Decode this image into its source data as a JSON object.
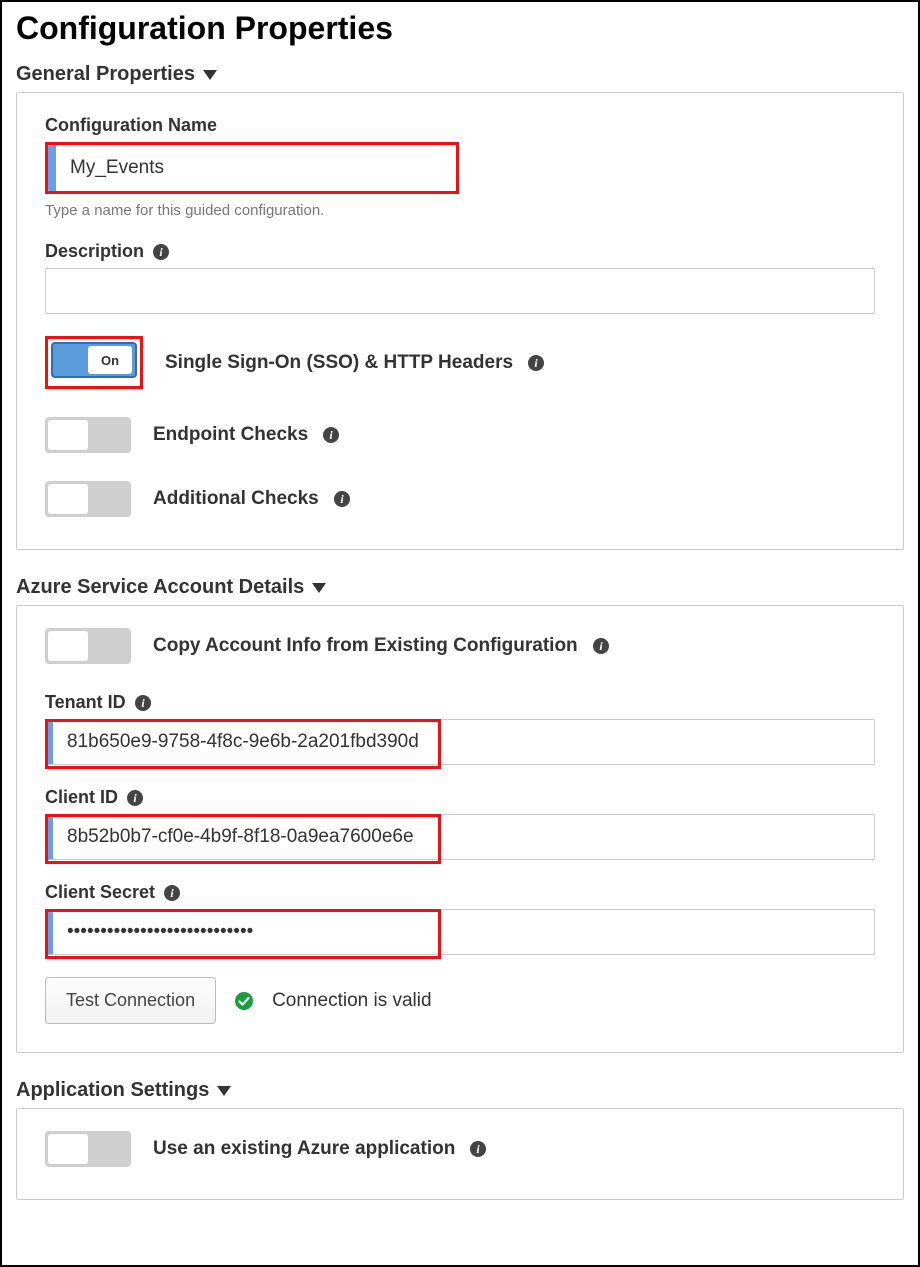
{
  "page_title": "Configuration Properties",
  "sections": {
    "general": {
      "title": "General Properties",
      "config_name_label": "Configuration Name",
      "config_name_value": "My_Events",
      "config_name_hint": "Type a name for this guided configuration.",
      "description_label": "Description",
      "description_value": "",
      "toggles": {
        "sso": {
          "on": true,
          "on_text": "On",
          "label": "Single Sign-On (SSO) & HTTP Headers"
        },
        "endpoint": {
          "on": false,
          "label": "Endpoint Checks"
        },
        "additional": {
          "on": false,
          "label": "Additional Checks"
        }
      }
    },
    "azure": {
      "title": "Azure Service Account Details",
      "copy_toggle": {
        "on": false,
        "label": "Copy Account Info from Existing Configuration"
      },
      "tenant_id_label": "Tenant ID",
      "tenant_id_value": "81b650e9-9758-4f8c-9e6b-2a201fbd390d",
      "client_id_label": "Client ID",
      "client_id_value": "8b52b0b7-cf0e-4b9f-8f18-0a9ea7600e6e",
      "client_secret_label": "Client Secret",
      "client_secret_value": "••••••••••••••••••••••••••••",
      "test_button": "Test Connection",
      "test_status": "Connection is valid"
    },
    "app": {
      "title": "Application Settings",
      "use_existing": {
        "on": false,
        "label": "Use an existing Azure application"
      }
    }
  }
}
